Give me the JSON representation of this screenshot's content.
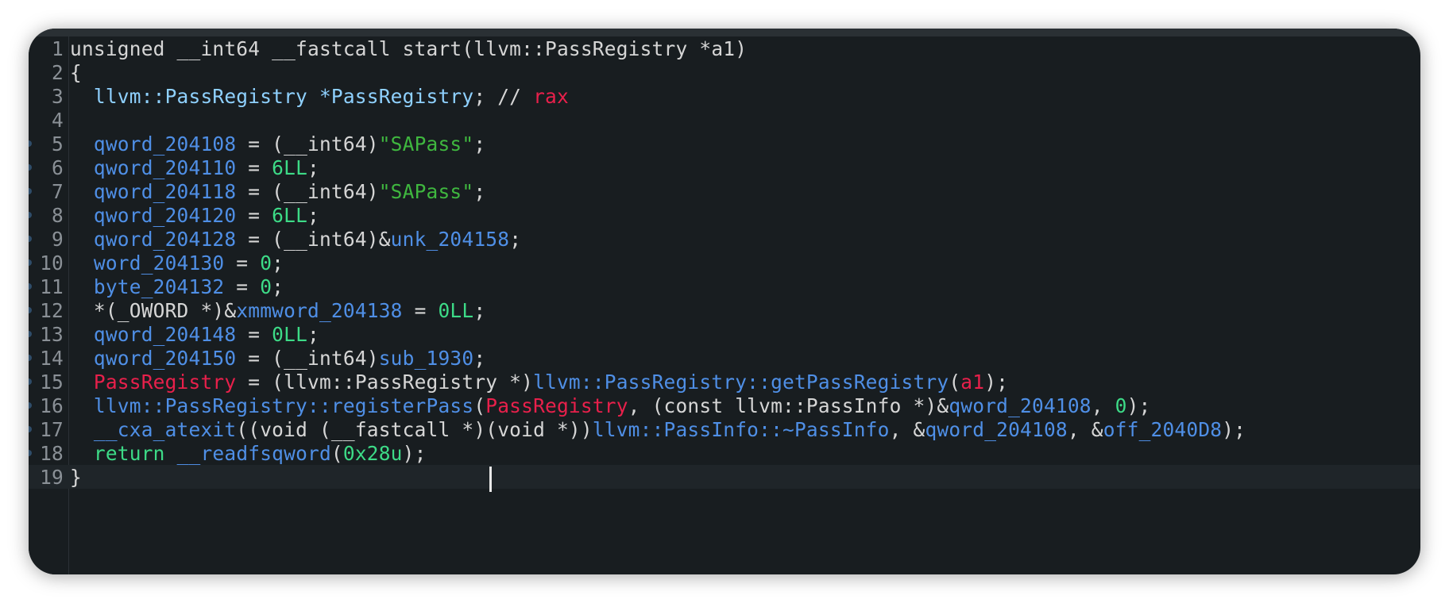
{
  "editor": {
    "lines": [
      {
        "no": "1",
        "tokens": [
          {
            "t": "unsigned __int64 __fastcall start(llvm::PassRegistry *a1)",
            "c": "plain"
          }
        ]
      },
      {
        "no": "2",
        "tokens": [
          {
            "t": "{",
            "c": "plain"
          }
        ]
      },
      {
        "no": "3",
        "tokens": [
          {
            "t": "  llvm::PassRegistry *PassRegistry",
            "c": "type"
          },
          {
            "t": "; // ",
            "c": "plain"
          },
          {
            "t": "rax",
            "c": "red"
          }
        ]
      },
      {
        "no": "4",
        "tokens": []
      },
      {
        "no": "5",
        "tokens": [
          {
            "t": "  qword_204108",
            "c": "var"
          },
          {
            "t": " = (__int64)",
            "c": "plain"
          },
          {
            "t": "\"SAPass\"",
            "c": "str"
          },
          {
            "t": ";",
            "c": "plain"
          }
        ]
      },
      {
        "no": "6",
        "tokens": [
          {
            "t": "  qword_204110",
            "c": "var"
          },
          {
            "t": " = ",
            "c": "plain"
          },
          {
            "t": "6LL",
            "c": "num"
          },
          {
            "t": ";",
            "c": "plain"
          }
        ]
      },
      {
        "no": "7",
        "tokens": [
          {
            "t": "  qword_204118",
            "c": "var"
          },
          {
            "t": " = (__int64)",
            "c": "plain"
          },
          {
            "t": "\"SAPass\"",
            "c": "str"
          },
          {
            "t": ";",
            "c": "plain"
          }
        ]
      },
      {
        "no": "8",
        "tokens": [
          {
            "t": "  qword_204120",
            "c": "var"
          },
          {
            "t": " = ",
            "c": "plain"
          },
          {
            "t": "6LL",
            "c": "num"
          },
          {
            "t": ";",
            "c": "plain"
          }
        ]
      },
      {
        "no": "9",
        "tokens": [
          {
            "t": "  qword_204128",
            "c": "var"
          },
          {
            "t": " = (__int64)&",
            "c": "plain"
          },
          {
            "t": "unk_204158",
            "c": "var"
          },
          {
            "t": ";",
            "c": "plain"
          }
        ]
      },
      {
        "no": "10",
        "tokens": [
          {
            "t": "  word_204130",
            "c": "var"
          },
          {
            "t": " = ",
            "c": "plain"
          },
          {
            "t": "0",
            "c": "num"
          },
          {
            "t": ";",
            "c": "plain"
          }
        ]
      },
      {
        "no": "11",
        "tokens": [
          {
            "t": "  byte_204132",
            "c": "var"
          },
          {
            "t": " = ",
            "c": "plain"
          },
          {
            "t": "0",
            "c": "num"
          },
          {
            "t": ";",
            "c": "plain"
          }
        ]
      },
      {
        "no": "12",
        "tokens": [
          {
            "t": "  *(_OWORD *)&",
            "c": "plain"
          },
          {
            "t": "xmmword_204138",
            "c": "var"
          },
          {
            "t": " = ",
            "c": "plain"
          },
          {
            "t": "0LL",
            "c": "num"
          },
          {
            "t": ";",
            "c": "plain"
          }
        ]
      },
      {
        "no": "13",
        "tokens": [
          {
            "t": "  qword_204148",
            "c": "var"
          },
          {
            "t": " = ",
            "c": "plain"
          },
          {
            "t": "0LL",
            "c": "num"
          },
          {
            "t": ";",
            "c": "plain"
          }
        ]
      },
      {
        "no": "14",
        "tokens": [
          {
            "t": "  qword_204150",
            "c": "var"
          },
          {
            "t": " = (__int64)",
            "c": "plain"
          },
          {
            "t": "sub_1930",
            "c": "var"
          },
          {
            "t": ";",
            "c": "plain"
          }
        ]
      },
      {
        "no": "15",
        "tokens": [
          {
            "t": "  PassRegistry",
            "c": "red"
          },
          {
            "t": " = (llvm::PassRegistry *)",
            "c": "plain"
          },
          {
            "t": "llvm::PassRegistry::getPassRegistry",
            "c": "var"
          },
          {
            "t": "(",
            "c": "plain"
          },
          {
            "t": "a1",
            "c": "red"
          },
          {
            "t": ");",
            "c": "plain"
          }
        ]
      },
      {
        "no": "16",
        "tokens": [
          {
            "t": "  llvm::PassRegistry::registerPass",
            "c": "var"
          },
          {
            "t": "(",
            "c": "plain"
          },
          {
            "t": "PassRegistry",
            "c": "red"
          },
          {
            "t": ", (const llvm::PassInfo *)&",
            "c": "plain"
          },
          {
            "t": "qword_204108",
            "c": "var"
          },
          {
            "t": ", ",
            "c": "plain"
          },
          {
            "t": "0",
            "c": "num"
          },
          {
            "t": ");",
            "c": "plain"
          }
        ]
      },
      {
        "no": "17",
        "tokens": [
          {
            "t": "  __cxa_atexit",
            "c": "var"
          },
          {
            "t": "((void (__fastcall *)(void *))",
            "c": "plain"
          },
          {
            "t": "llvm::PassInfo::~PassInfo",
            "c": "var"
          },
          {
            "t": ", &",
            "c": "plain"
          },
          {
            "t": "qword_204108",
            "c": "var"
          },
          {
            "t": ", &",
            "c": "plain"
          },
          {
            "t": "off_2040D8",
            "c": "var"
          },
          {
            "t": ");",
            "c": "plain"
          }
        ]
      },
      {
        "no": "18",
        "tokens": [
          {
            "t": "  return ",
            "c": "kw"
          },
          {
            "t": "__readfsqword",
            "c": "var"
          },
          {
            "t": "(",
            "c": "plain"
          },
          {
            "t": "0x28u",
            "c": "num"
          },
          {
            "t": ");",
            "c": "plain"
          }
        ]
      },
      {
        "no": "19",
        "tokens": [
          {
            "t": "}",
            "c": "plain"
          }
        ]
      }
    ],
    "current_line": "19",
    "colors": {
      "background": "#181d20",
      "variable": "#4f8fe6",
      "number": "#3ddb87",
      "string": "#3fb73f",
      "register": "#e8204b",
      "type": "#8fd1ff",
      "plain": "#d6d6d6"
    }
  }
}
